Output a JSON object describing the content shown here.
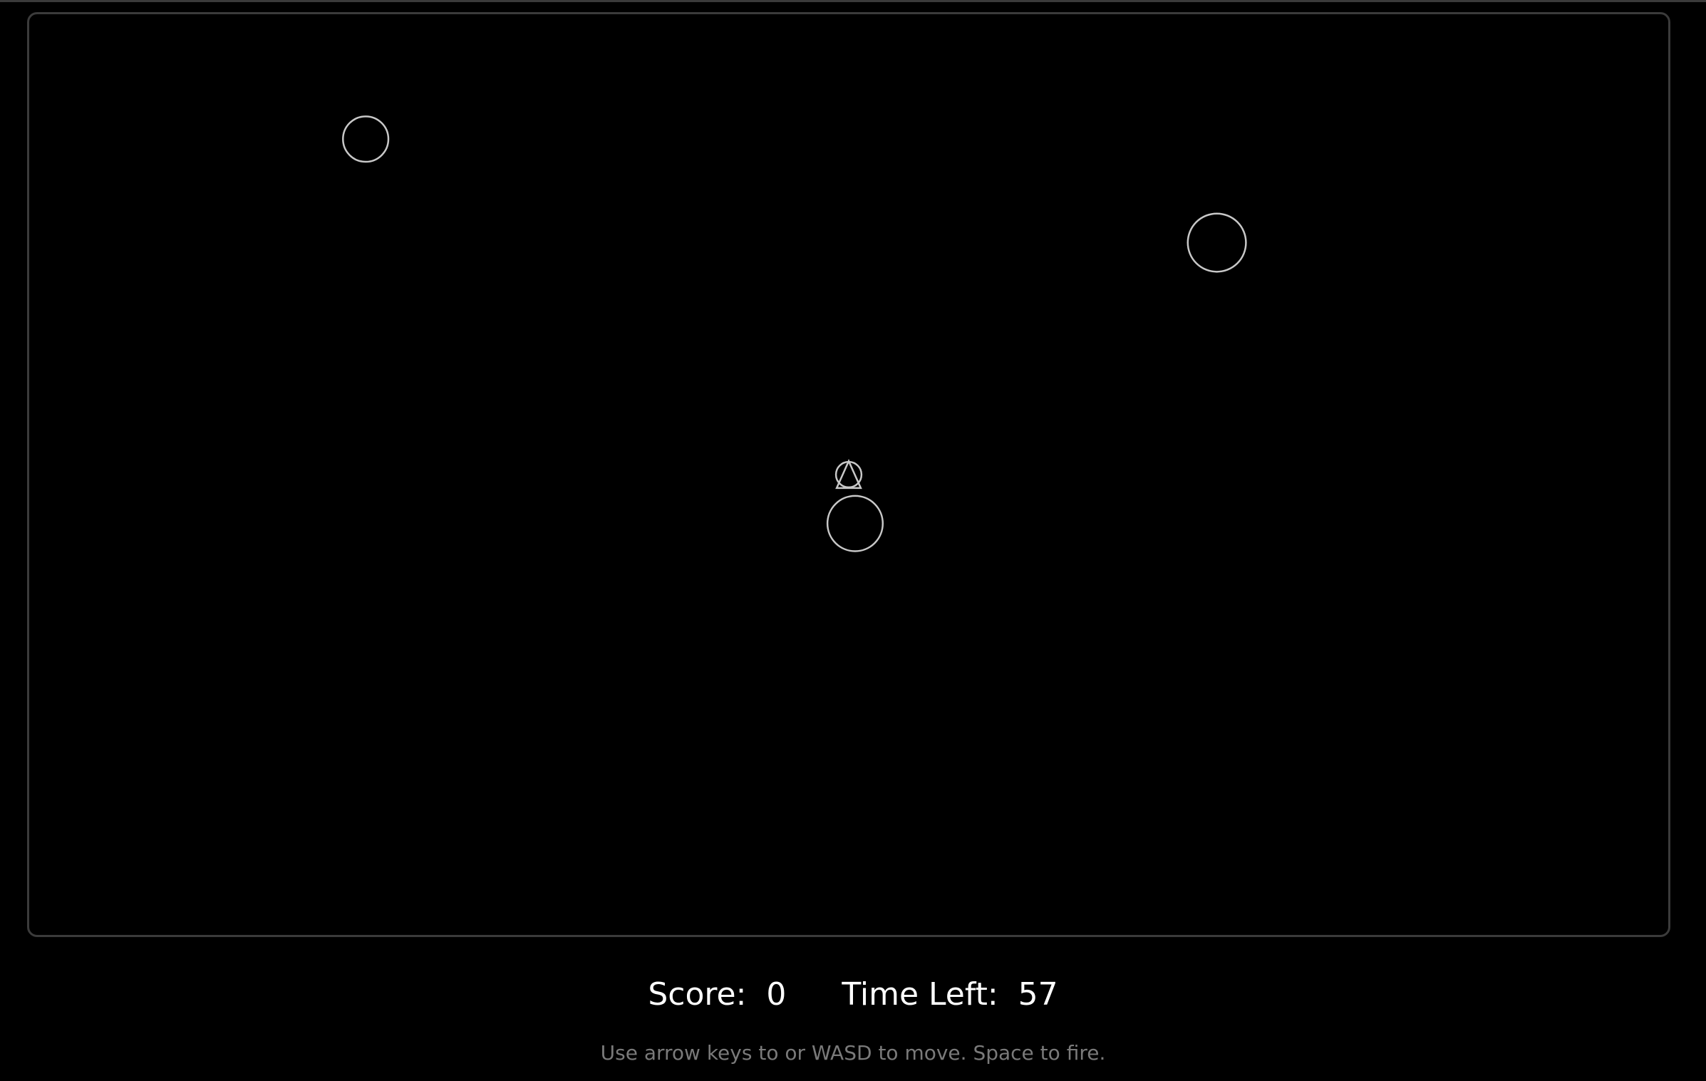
{
  "hud": {
    "score_label": "Score:",
    "score_value": "0",
    "time_label": "Time Left:",
    "time_value": "57"
  },
  "instructions": "Use arrow keys to or WASD to move. Space to fire.",
  "colors": {
    "background": "#000000",
    "frame_border": "#3b3b3b",
    "sprite_stroke": "#c8c8c8",
    "hud_text": "#ffffff",
    "instructions_text": "#7a7a7a"
  },
  "entities": {
    "player": "triangle-ship",
    "asteroids": [
      "asteroid",
      "asteroid",
      "asteroid"
    ]
  }
}
